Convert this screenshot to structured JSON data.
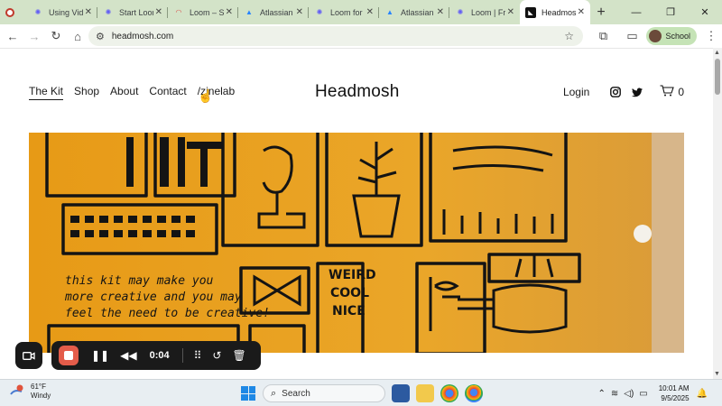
{
  "browser": {
    "tabs": [
      {
        "title": "",
        "icon": "recording-icon",
        "active": false
      },
      {
        "title": "Using Vidi",
        "icon": "loom-icon",
        "active": false
      },
      {
        "title": "Start Loom",
        "icon": "loom-icon",
        "active": false
      },
      {
        "title": "Loom – Sc",
        "icon": "loom-screen-icon",
        "active": false
      },
      {
        "title": "Atlassian",
        "icon": "atlassian-icon",
        "active": false
      },
      {
        "title": "Loom for",
        "icon": "loom-icon",
        "active": false
      },
      {
        "title": "Atlassian",
        "icon": "atlassian-icon",
        "active": false
      },
      {
        "title": "Loom | Fre",
        "icon": "loom-icon",
        "active": false
      },
      {
        "title": "Headmosh",
        "icon": "headmosh-icon",
        "active": true
      }
    ],
    "new_tab": "+",
    "url": "headmosh.com",
    "profile_label": "School"
  },
  "site": {
    "nav": [
      "The Kit",
      "Shop",
      "About",
      "Contact",
      "/zinelab"
    ],
    "current_nav": "The Kit",
    "brand": "Headmosh",
    "login": "Login",
    "cart_count": "0",
    "hero_texts": {
      "line1": "this kit may make you",
      "line2": "more creative and you may",
      "line3": "feel the need to be creative!",
      "weird": "WEIRD",
      "cool": "COOL",
      "nice": "NICE"
    }
  },
  "recorder": {
    "time": "0:04"
  },
  "taskbar": {
    "temperature": "61°F",
    "condition": "Windy",
    "search_placeholder": "Search",
    "time": "10:01 AM",
    "date": "9/5/2025"
  },
  "colors": {
    "tab_strip": "#d3e3c8",
    "hero_orange": "#e8a21f",
    "record_red": "#e45c4a"
  }
}
